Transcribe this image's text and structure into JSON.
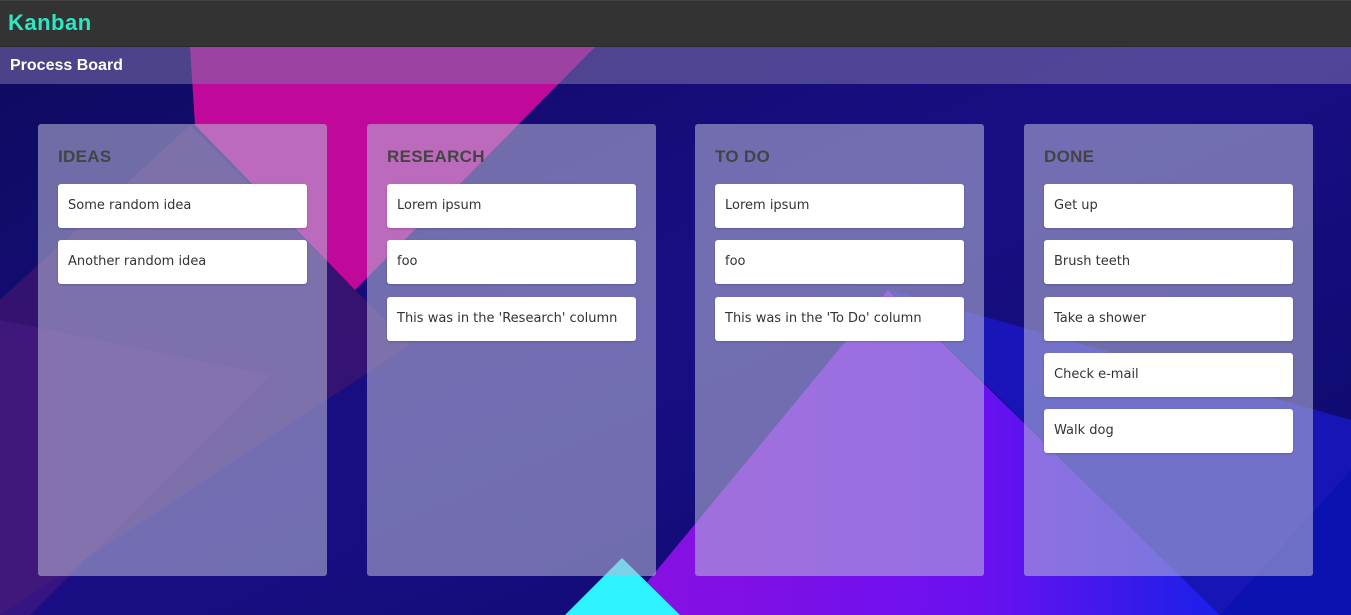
{
  "app": {
    "title": "Kanban"
  },
  "board": {
    "title": "Process Board"
  },
  "columns": [
    {
      "title": "IDEAS",
      "cards": [
        "Some random idea",
        "Another random idea"
      ]
    },
    {
      "title": "RESEARCH",
      "cards": [
        "Lorem ipsum",
        "foo",
        "This was in the 'Research' column"
      ]
    },
    {
      "title": "TO DO",
      "cards": [
        "Lorem ipsum",
        "foo",
        "This was in the 'To Do' column"
      ]
    },
    {
      "title": "DONE",
      "cards": [
        "Get up",
        "Brush teeth",
        "Take a shower",
        "Check e-mail",
        "Walk dog"
      ]
    }
  ],
  "colors": {
    "topbar": "#333333",
    "app_title": "#2ee6c0",
    "background": "#14106e",
    "card": "#ffffff",
    "column_title": "#444444"
  }
}
